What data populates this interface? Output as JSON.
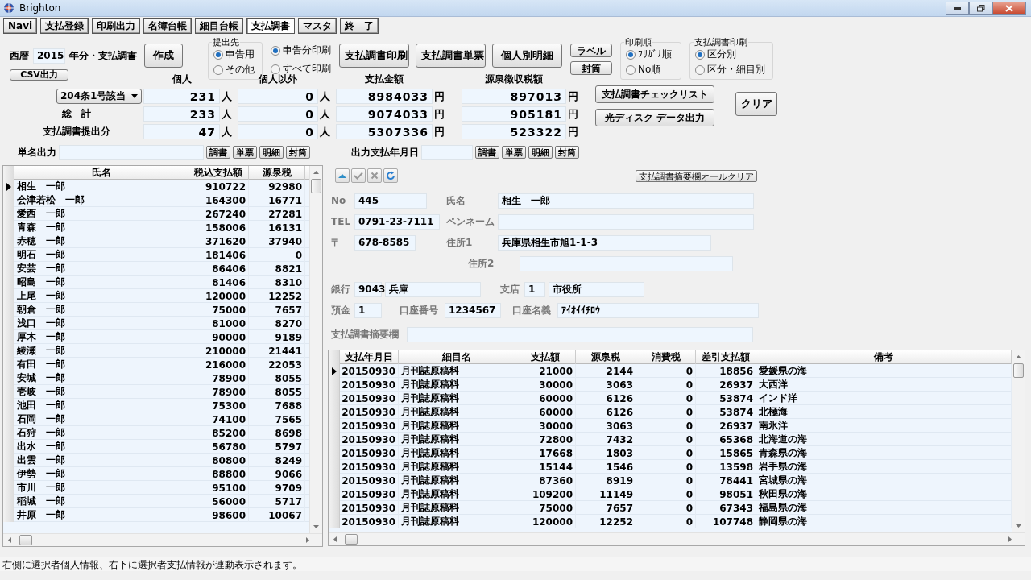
{
  "window": {
    "title": "Brighton"
  },
  "menu": [
    {
      "label": "Navi",
      "selected": false
    },
    {
      "label": "支払登録",
      "selected": false
    },
    {
      "label": "印刷出力",
      "selected": false
    },
    {
      "label": "名簿台帳",
      "selected": false
    },
    {
      "label": "細目台帳",
      "selected": false
    },
    {
      "label": "支払調書",
      "selected": true
    },
    {
      "label": "マスタ",
      "selected": false
    },
    {
      "label": "終　了",
      "selected": false
    }
  ],
  "header": {
    "era_label": "西暦",
    "year": "2015",
    "year_suffix": "年分・支払調書",
    "create_button": "作成",
    "csv_button": "CSV出力"
  },
  "submit_to": {
    "title": "提出先",
    "options": [
      {
        "label": "申告用",
        "selected": true
      },
      {
        "label": "その他",
        "selected": false
      }
    ]
  },
  "print_scope": {
    "options": [
      {
        "label": "申告分印刷",
        "selected": true
      },
      {
        "label": "すべて印刷",
        "selected": false
      }
    ]
  },
  "print_buttons": [
    "支払調書印刷",
    "支払調書単票",
    "個人別明細"
  ],
  "small_buttons": [
    "ラベル",
    "封筒"
  ],
  "print_order": {
    "title": "印刷順",
    "options": [
      {
        "label": "ﾌﾘｶﾞﾅ順",
        "selected": true
      },
      {
        "label": "No順",
        "selected": false
      }
    ]
  },
  "report_print": {
    "title": "支払調書印刷",
    "options": [
      {
        "label": "区分別",
        "selected": true
      },
      {
        "label": "区分・細目別",
        "selected": false
      }
    ]
  },
  "summary": {
    "columns": [
      "個人",
      "個人以外",
      "支払金額",
      "源泉徴収税額"
    ],
    "rows": [
      {
        "kind": "dropdown",
        "label": "204条1号該当",
        "values": [
          {
            "value": "231",
            "unit": "人"
          },
          {
            "value": "0",
            "unit": "人"
          },
          {
            "value": "8984033",
            "unit": "円"
          },
          {
            "value": "897013",
            "unit": "円"
          }
        ]
      },
      {
        "kind": "text",
        "label": "総　計",
        "values": [
          {
            "value": "233",
            "unit": "人"
          },
          {
            "value": "0",
            "unit": "人"
          },
          {
            "value": "9074033",
            "unit": "円"
          },
          {
            "value": "905181",
            "unit": "円"
          }
        ]
      },
      {
        "kind": "text",
        "label": "支払調書提出分",
        "values": [
          {
            "value": "47",
            "unit": "人"
          },
          {
            "value": "0",
            "unit": "人"
          },
          {
            "value": "5307336",
            "unit": "円"
          },
          {
            "value": "523322",
            "unit": "円"
          }
        ]
      }
    ]
  },
  "action_buttons": [
    "支払調書チェックリスト",
    "光ディスク データ出力"
  ],
  "clear_button": "クリア",
  "single_output": {
    "label": "単名出力",
    "buttons": [
      "調書",
      "単票",
      "明細",
      "封筒"
    ]
  },
  "date_output": {
    "label": "出力支払年月日",
    "buttons": [
      "調書",
      "単票",
      "明細",
      "封筒"
    ]
  },
  "people_table": {
    "columns": [
      "氏名",
      "税込支払額",
      "源泉税"
    ],
    "rows": [
      {
        "name": "相生　一郎",
        "amount": "910722",
        "tax": "92980",
        "selected": true
      },
      {
        "name": "会津若松　一郎",
        "amount": "164300",
        "tax": "16771",
        "selected": false
      },
      {
        "name": "愛西　一郎",
        "amount": "267240",
        "tax": "27281",
        "selected": false
      },
      {
        "name": "青森　一郎",
        "amount": "158006",
        "tax": "16131",
        "selected": false
      },
      {
        "name": "赤穂　一郎",
        "amount": "371620",
        "tax": "37940",
        "selected": false
      },
      {
        "name": "明石　一郎",
        "amount": "181406",
        "tax": "0",
        "selected": false
      },
      {
        "name": "安芸　一郎",
        "amount": "86406",
        "tax": "8821",
        "selected": false
      },
      {
        "name": "昭島　一郎",
        "amount": "81406",
        "tax": "8310",
        "selected": false
      },
      {
        "name": "上尾　一郎",
        "amount": "120000",
        "tax": "12252",
        "selected": false
      },
      {
        "name": "朝倉　一郎",
        "amount": "75000",
        "tax": "7657",
        "selected": false
      },
      {
        "name": "浅口　一郎",
        "amount": "81000",
        "tax": "8270",
        "selected": false
      },
      {
        "name": "厚木　一郎",
        "amount": "90000",
        "tax": "9189",
        "selected": false
      },
      {
        "name": "綾瀬　一郎",
        "amount": "210000",
        "tax": "21441",
        "selected": false
      },
      {
        "name": "有田　一郎",
        "amount": "216000",
        "tax": "22053",
        "selected": false
      },
      {
        "name": "安城　一郎",
        "amount": "78900",
        "tax": "8055",
        "selected": false
      },
      {
        "name": "壱岐　一郎",
        "amount": "78900",
        "tax": "8055",
        "selected": false
      },
      {
        "name": "池田　一郎",
        "amount": "75300",
        "tax": "7688",
        "selected": false
      },
      {
        "name": "石岡　一郎",
        "amount": "74100",
        "tax": "7565",
        "selected": false
      },
      {
        "name": "石狩　一郎",
        "amount": "85200",
        "tax": "8698",
        "selected": false
      },
      {
        "name": "出水　一郎",
        "amount": "56780",
        "tax": "5797",
        "selected": false
      },
      {
        "name": "出雲　一郎",
        "amount": "80800",
        "tax": "8249",
        "selected": false
      },
      {
        "name": "伊勢　一郎",
        "amount": "88800",
        "tax": "9066",
        "selected": false
      },
      {
        "name": "市川　一郎",
        "amount": "95100",
        "tax": "9709",
        "selected": false
      },
      {
        "name": "稲城　一郎",
        "amount": "56000",
        "tax": "5717",
        "selected": false
      },
      {
        "name": "井原　一郎",
        "amount": "98600",
        "tax": "10067",
        "selected": false
      }
    ]
  },
  "memo_clear_button": "支払調書摘要欄オールクリア",
  "person_form": {
    "no": {
      "label": "No",
      "value": "445"
    },
    "name": {
      "label": "氏名",
      "value": "相生　一郎"
    },
    "tel": {
      "label": "TEL",
      "value": "0791-23-7111"
    },
    "pen_name": {
      "label": "ペンネーム"
    },
    "zip": {
      "label": "〒",
      "value": "678-8585"
    },
    "address1": {
      "label": "住所1",
      "value": "兵庫県相生市旭1-1-3"
    },
    "address2": {
      "label": "住所2"
    },
    "bank": {
      "label": "銀行",
      "code": "9043",
      "value": "兵庫"
    },
    "branch": {
      "label": "支店",
      "code": "1",
      "value": "市役所"
    },
    "deposit": {
      "label": "預金",
      "value": "1"
    },
    "account_no": {
      "label": "口座番号",
      "value": "1234567"
    },
    "account_name": {
      "label": "口座名義",
      "value": "ｱｲｵｲｲﾁﾛｳ"
    },
    "memo": {
      "label": "支払調書摘要欄"
    }
  },
  "payments_table": {
    "columns": [
      "支払年月日",
      "細目名",
      "支払額",
      "源泉税",
      "消費税",
      "差引支払額",
      "備考"
    ],
    "rows": [
      {
        "selected": true,
        "cells": [
          "20150930",
          "月刊誌原稿料",
          "21000",
          "2144",
          "0",
          "18856",
          "愛媛県の海"
        ]
      },
      {
        "selected": false,
        "cells": [
          "20150930",
          "月刊誌原稿料",
          "30000",
          "3063",
          "0",
          "26937",
          "大西洋"
        ]
      },
      {
        "selected": false,
        "cells": [
          "20150930",
          "月刊誌原稿料",
          "60000",
          "6126",
          "0",
          "53874",
          "インド洋"
        ]
      },
      {
        "selected": false,
        "cells": [
          "20150930",
          "月刊誌原稿料",
          "60000",
          "6126",
          "0",
          "53874",
          "北極海"
        ]
      },
      {
        "selected": false,
        "cells": [
          "20150930",
          "月刊誌原稿料",
          "30000",
          "3063",
          "0",
          "26937",
          "南氷洋"
        ]
      },
      {
        "selected": false,
        "cells": [
          "20150930",
          "月刊誌原稿料",
          "72800",
          "7432",
          "0",
          "65368",
          "北海道の海"
        ]
      },
      {
        "selected": false,
        "cells": [
          "20150930",
          "月刊誌原稿料",
          "17668",
          "1803",
          "0",
          "15865",
          "青森県の海"
        ]
      },
      {
        "selected": false,
        "cells": [
          "20150930",
          "月刊誌原稿料",
          "15144",
          "1546",
          "0",
          "13598",
          "岩手県の海"
        ]
      },
      {
        "selected": false,
        "cells": [
          "20150930",
          "月刊誌原稿料",
          "87360",
          "8919",
          "0",
          "78441",
          "宮城県の海"
        ]
      },
      {
        "selected": false,
        "cells": [
          "20150930",
          "月刊誌原稿料",
          "109200",
          "11149",
          "0",
          "98051",
          "秋田県の海"
        ]
      },
      {
        "selected": false,
        "cells": [
          "20150930",
          "月刊誌原稿料",
          "75000",
          "7657",
          "0",
          "67343",
          "福島県の海"
        ]
      },
      {
        "selected": false,
        "cells": [
          "20150930",
          "月刊誌原稿料",
          "120000",
          "12252",
          "0",
          "107748",
          "静岡県の海"
        ]
      }
    ]
  },
  "status_bar": "右側に選択者個人情報、右下に選択者支払情報が連動表示されます。"
}
